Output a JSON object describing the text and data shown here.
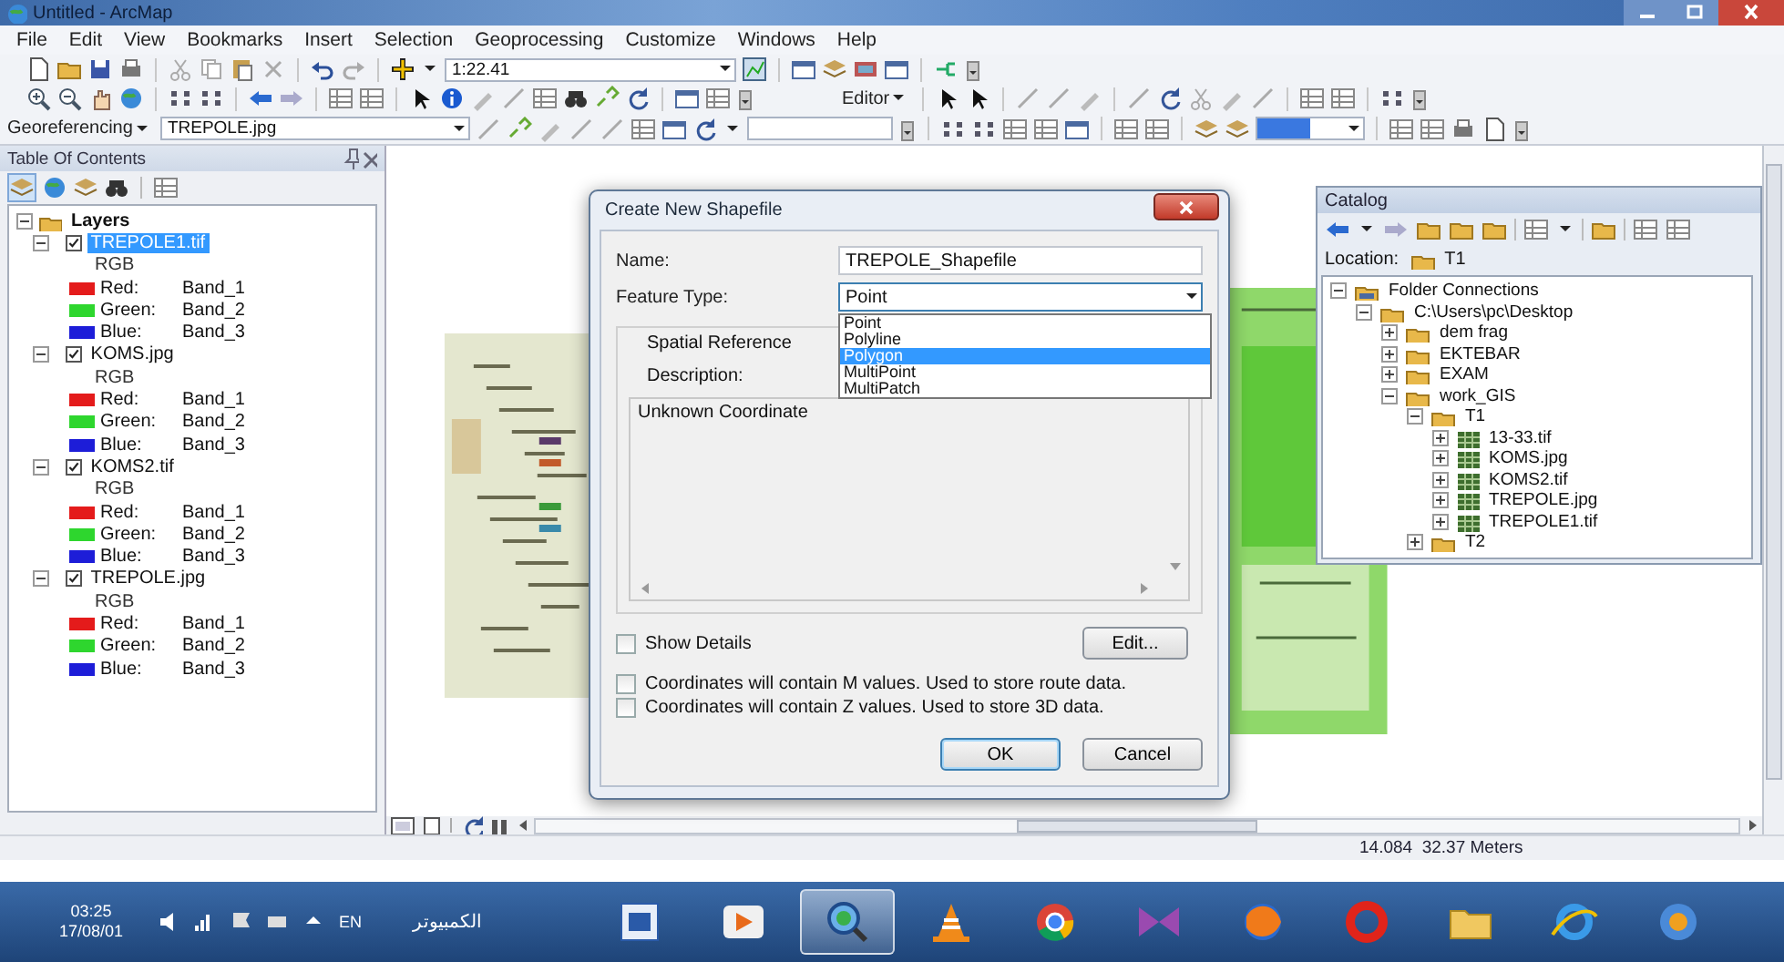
{
  "window": {
    "title": "Untitled - ArcMap"
  },
  "menu": [
    "File",
    "Edit",
    "View",
    "Bookmarks",
    "Insert",
    "Selection",
    "Geoprocessing",
    "Customize",
    "Windows",
    "Help"
  ],
  "standard_toolbar": {
    "scale": "1:22.41"
  },
  "editor_toolbar": {
    "label": "Editor"
  },
  "georeferencing_toolbar": {
    "label": "Georeferencing",
    "layer": "TREPOLE.jpg"
  },
  "toc": {
    "title": "Table Of Contents",
    "root": {
      "label": "Layers",
      "expanded": true
    },
    "layers": [
      {
        "name": "TREPOLE1.tif",
        "checked": true,
        "selected": true,
        "expanded": true,
        "renderer": "RGB",
        "bands": [
          {
            "channel": "Red:",
            "band": "Band_1",
            "color": "#e41b1b"
          },
          {
            "channel": "Green:",
            "band": "Band_2",
            "color": "#2ed62e"
          },
          {
            "channel": "Blue:",
            "band": "Band_3",
            "color": "#1d1dd8"
          }
        ]
      },
      {
        "name": "KOMS.jpg",
        "checked": true,
        "selected": false,
        "expanded": true,
        "renderer": "RGB",
        "bands": [
          {
            "channel": "Red:",
            "band": "Band_1",
            "color": "#e41b1b"
          },
          {
            "channel": "Green:",
            "band": "Band_2",
            "color": "#2ed62e"
          },
          {
            "channel": "Blue:",
            "band": "Band_3",
            "color": "#1d1dd8"
          }
        ]
      },
      {
        "name": "KOMS2.tif",
        "checked": true,
        "selected": false,
        "expanded": true,
        "renderer": "RGB",
        "bands": [
          {
            "channel": "Red:",
            "band": "Band_1",
            "color": "#e41b1b"
          },
          {
            "channel": "Green:",
            "band": "Band_2",
            "color": "#2ed62e"
          },
          {
            "channel": "Blue:",
            "band": "Band_3",
            "color": "#1d1dd8"
          }
        ]
      },
      {
        "name": "TREPOLE.jpg",
        "checked": true,
        "selected": false,
        "expanded": true,
        "renderer": "RGB",
        "bands": [
          {
            "channel": "Red:",
            "band": "Band_1",
            "color": "#e41b1b"
          },
          {
            "channel": "Green:",
            "band": "Band_2",
            "color": "#2ed62e"
          },
          {
            "channel": "Blue:",
            "band": "Band_3",
            "color": "#1d1dd8"
          }
        ]
      }
    ]
  },
  "dialog": {
    "title": "Create New Shapefile",
    "name_label": "Name:",
    "name_value": "TREPOLE_Shapefile",
    "feature_type_label": "Feature Type:",
    "feature_type_value": "Point",
    "dropdown_expanded": true,
    "options": [
      {
        "label": "Point",
        "selected": false
      },
      {
        "label": "Polyline",
        "selected": false
      },
      {
        "label": "Polygon",
        "selected": true
      },
      {
        "label": "MultiPoint",
        "selected": false
      },
      {
        "label": "MultiPatch",
        "selected": false
      }
    ],
    "spatial_reference_label": "Spatial Reference",
    "description_label": "Description:",
    "description": "Unknown Coordinate",
    "show_details": {
      "label": "Show Details",
      "checked": false
    },
    "edit_button": "Edit...",
    "checks": [
      {
        "label": "Coordinates will contain M values. Used to store route data.",
        "checked": false
      },
      {
        "label": "Coordinates will contain Z values. Used to store 3D data.",
        "checked": false
      }
    ],
    "buttons": [
      "OK",
      "Cancel"
    ]
  },
  "catalog": {
    "title": "Catalog",
    "location_label": "Location:",
    "location": "T1",
    "tree": [
      {
        "label": "Folder Connections",
        "kind": "connections",
        "expanded": true,
        "children": [
          {
            "label": "C:\\Users\\pc\\Desktop",
            "kind": "folder",
            "expanded": true,
            "children": [
              {
                "label": "dem frag",
                "kind": "folder",
                "expanded": false
              },
              {
                "label": "EKTEBAR",
                "kind": "folder",
                "expanded": false
              },
              {
                "label": "EXAM",
                "kind": "folder",
                "expanded": false
              },
              {
                "label": "work_GIS",
                "kind": "folder",
                "expanded": true,
                "children": [
                  {
                    "label": "T1",
                    "kind": "folder",
                    "expanded": true,
                    "children": [
                      {
                        "label": "13-33.tif",
                        "kind": "raster",
                        "expanded": false
                      },
                      {
                        "label": "KOMS.jpg",
                        "kind": "raster",
                        "expanded": false
                      },
                      {
                        "label": "KOMS2.tif",
                        "kind": "raster",
                        "expanded": false
                      },
                      {
                        "label": "TREPOLE.jpg",
                        "kind": "raster",
                        "expanded": false
                      },
                      {
                        "label": "TREPOLE1.tif",
                        "kind": "raster",
                        "expanded": false
                      }
                    ]
                  },
                  {
                    "label": "T2",
                    "kind": "folder",
                    "expanded": false
                  }
                ]
              }
            ]
          }
        ]
      }
    ]
  },
  "status_bar": {
    "coordinates": "14.084  32.37 Meters"
  },
  "taskbar": {
    "time": "03:25",
    "date": "17/08/01",
    "language": "EN",
    "toolbar_label": "الكمبيوتر",
    "apps": [
      {
        "kind": "document",
        "active": false
      },
      {
        "kind": "media",
        "active": false
      },
      {
        "kind": "magnifier",
        "active": true
      },
      {
        "kind": "cone",
        "active": false
      },
      {
        "kind": "ring",
        "active": false
      },
      {
        "kind": "bowtie",
        "active": false
      },
      {
        "kind": "globe",
        "active": false
      },
      {
        "kind": "oring",
        "active": false
      },
      {
        "kind": "folder",
        "active": false
      },
      {
        "kind": "swoosh",
        "active": false
      },
      {
        "kind": "orb",
        "active": false
      }
    ]
  }
}
